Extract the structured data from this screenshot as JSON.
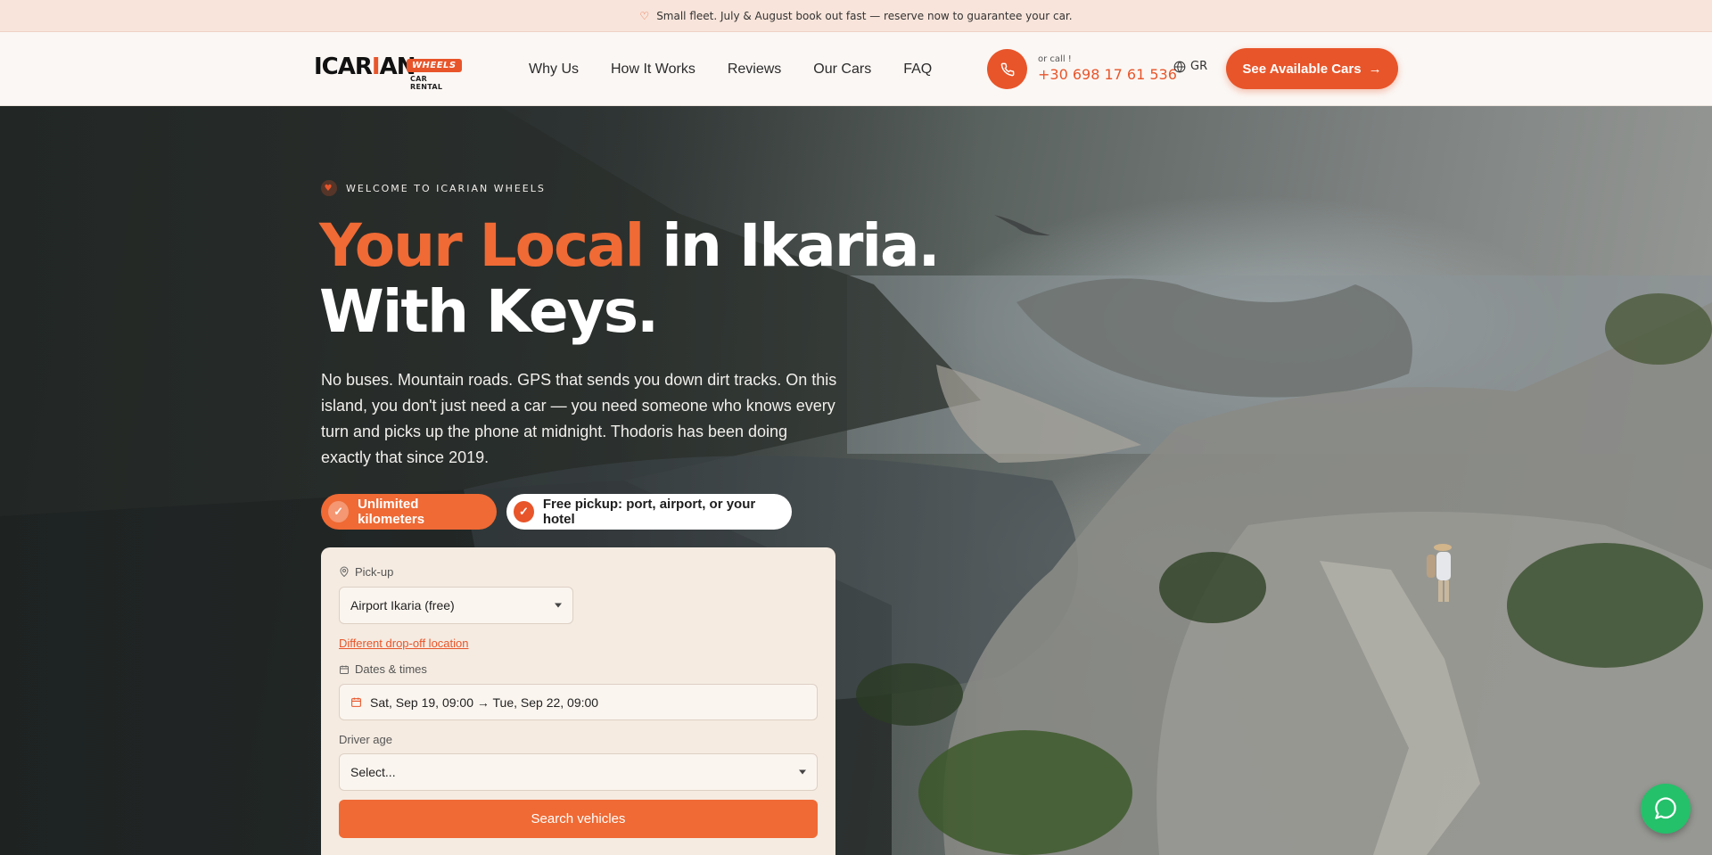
{
  "announcement": {
    "text": "Small fleet. July & August book out fast — reserve now to guarantee your car."
  },
  "header": {
    "logo": {
      "word_a": "ICAR",
      "word_b": "I",
      "word_c": "AN",
      "pill": "WHEELS",
      "sub": "CAR RENTAL"
    },
    "nav": [
      "Why Us",
      "How It Works",
      "Reviews",
      "Our Cars",
      "FAQ"
    ],
    "or_call": "or call !",
    "phone": "+30 698 17 61 536",
    "lang": "GR",
    "cta": "See Available Cars",
    "cta_arrow": "→"
  },
  "hero": {
    "eyebrow": "WELCOME TO ICARIAN WHEELS",
    "headline_accent": "Your Local",
    "headline_rest": " in Ikaria.",
    "headline_line2": "With Keys.",
    "lead": "No buses. Mountain roads. GPS that sends you down dirt tracks. On this island, you don't just need a car — you need someone who knows every turn and picks up the phone at midnight. Thodoris has been doing exactly that since 2019.",
    "chips": [
      "Unlimited kilometers",
      "Free pickup: port, airport, or your hotel"
    ]
  },
  "booking": {
    "pickup_label": "Pick-up",
    "pickup_value": "Airport Ikaria (free)",
    "dropoff_link": "Different drop-off location",
    "dates_label": "Dates & times",
    "dates_value": "Sat, Sep 19, 09:00 → Tue, Sep 22, 09:00",
    "age_label": "Driver age",
    "age_value": "Select...",
    "search_button": "Search vehicles"
  },
  "colors": {
    "accent": "#e8552a",
    "chat": "#25c06a"
  }
}
